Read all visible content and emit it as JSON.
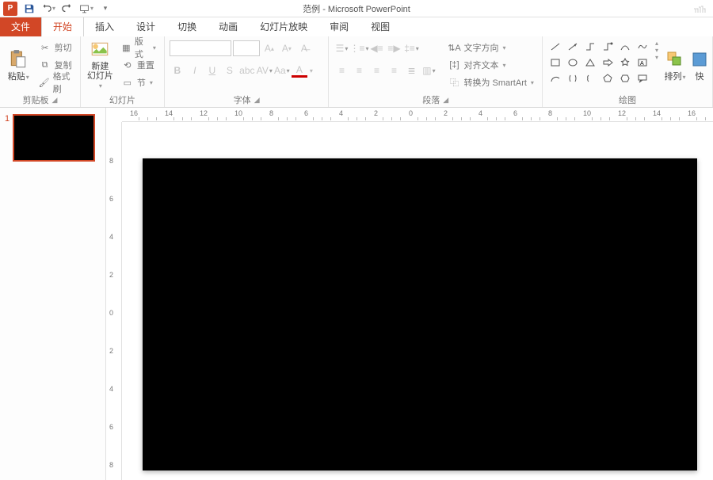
{
  "app": {
    "title": "范例 - Microsoft PowerPoint"
  },
  "tabs": {
    "file": "文件",
    "home": "开始",
    "insert": "插入",
    "design": "设计",
    "transitions": "切换",
    "animations": "动画",
    "slideshow": "幻灯片放映",
    "review": "审阅",
    "view": "视图"
  },
  "clipboard": {
    "paste": "粘贴",
    "cut": "剪切",
    "copy": "复制",
    "format_painter": "格式刷",
    "group": "剪贴板"
  },
  "slides": {
    "new_slide": "新建\n幻灯片",
    "layout": "版式",
    "reset": "重置",
    "section": "节",
    "group": "幻灯片"
  },
  "font": {
    "group": "字体",
    "name_ph": "",
    "size_ph": ""
  },
  "paragraph": {
    "text_direction": "文字方向",
    "align_text": "对齐文本",
    "convert_smartart": "转换为 SmartArt",
    "group": "段落"
  },
  "drawing": {
    "arrange": "排列",
    "quick": "快",
    "group": "绘图"
  },
  "ruler_h": [
    "16",
    "14",
    "12",
    "10",
    "8",
    "6",
    "4",
    "2",
    "0",
    "2",
    "4",
    "6",
    "8",
    "10",
    "12",
    "14",
    "16"
  ],
  "ruler_v": [
    "8",
    "6",
    "4",
    "2",
    "0",
    "2",
    "4",
    "6",
    "8"
  ],
  "slide_panel": {
    "num": "1"
  }
}
